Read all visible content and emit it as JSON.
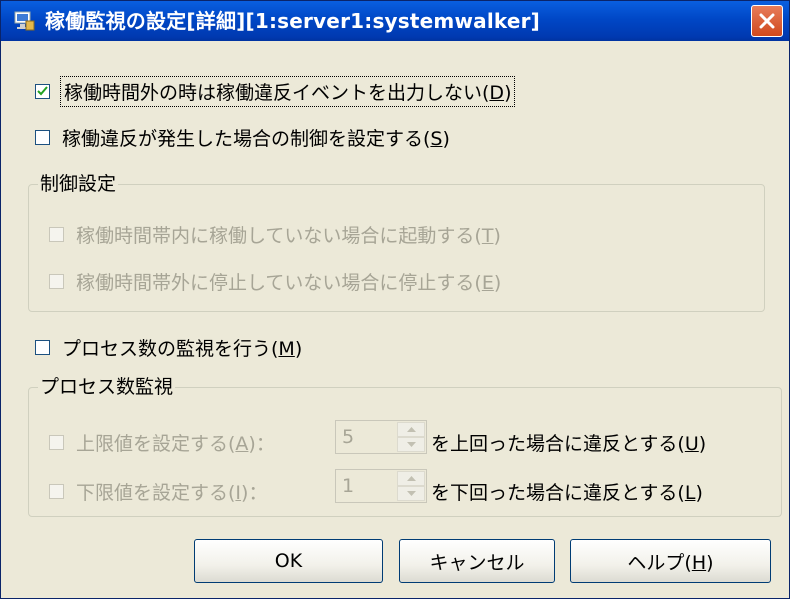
{
  "window": {
    "title": "稼働監視の設定[詳細][1:server1:systemwalker]",
    "icon": "monitor-settings-icon",
    "close_icon": "close-icon",
    "close_color": "#d0491d",
    "titlebar_color": "#0047c6"
  },
  "options": {
    "no_violation_event": {
      "label": "稼働時間外の時は稼働違反イベントを出力しない(",
      "key": "D",
      "end": ")",
      "checked": true
    },
    "set_violation_control": {
      "label": "稼働違反が発生した場合の制御を設定する(",
      "key": "S",
      "end": ")",
      "checked": false
    },
    "monitor_process_count": {
      "label": "プロセス数の監視を行う(",
      "key": "M",
      "end": ")",
      "checked": false
    }
  },
  "control_group": {
    "title": "制御設定",
    "start_in_hours": {
      "label": "稼働時間帯内に稼働していない場合に起動する(",
      "key": "T",
      "end": ")",
      "checked": false
    },
    "stop_out_hours": {
      "label": "稼働時間帯外に停止していない場合に停止する(",
      "key": "E",
      "end": ")",
      "checked": false
    }
  },
  "process_group": {
    "title": "プロセス数監視",
    "upper": {
      "label": "上限値を設定する(",
      "key": "A",
      "end": ")：",
      "value": "5",
      "suffix": "を上回った場合に違反とする(",
      "suffix_key": "U",
      "suffix_end": ")"
    },
    "lower": {
      "label": "下限値を設定する(",
      "key": "I",
      "end": ")：",
      "value": "1",
      "suffix": "を下回った場合に違反とする(",
      "suffix_key": "L",
      "suffix_end": ")"
    }
  },
  "buttons": {
    "ok": "OK",
    "cancel": "キャンセル",
    "help": "ヘルプ(",
    "help_key": "H",
    "help_end": ")"
  }
}
